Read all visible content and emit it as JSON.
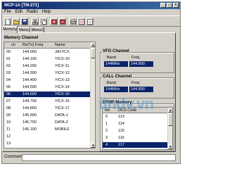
{
  "window": {
    "title": "MCP-1A [TM-271]",
    "controls": [
      "_",
      "□",
      "×"
    ]
  },
  "menu": [
    "File",
    "Edit",
    "Radio",
    "Help"
  ],
  "tabs": [
    "Memory",
    "Menu",
    "Menu2"
  ],
  "memory_channel": {
    "title": "Memory Channel",
    "columns": [
      "ch",
      "Rx(Tx) Freq",
      "Name"
    ],
    "rows": [
      {
        "ch": "00",
        "freq": "144.000",
        "name": "JA1YCX"
      },
      {
        "ch": "01",
        "freq": "144.100",
        "name": "YICX-10"
      },
      {
        "ch": "02",
        "freq": "144.200",
        "name": "YICX-11"
      },
      {
        "ch": "03",
        "freq": "144.300",
        "name": "YICX-12"
      },
      {
        "ch": "04",
        "freq": "144.400",
        "name": "YICX-13"
      },
      {
        "ch": "05",
        "freq": "144.500",
        "name": "YICX-14"
      },
      {
        "ch": "06",
        "freq": "144.600",
        "name": "YICX-15"
      },
      {
        "ch": "07",
        "freq": "144.700",
        "name": "YICX-16"
      },
      {
        "ch": "08",
        "freq": "144.800",
        "name": "YICX-17"
      },
      {
        "ch": "09",
        "freq": "145.600",
        "name": "DATA-1"
      },
      {
        "ch": "10",
        "freq": "145.700",
        "name": "DATA-2"
      },
      {
        "ch": "11",
        "freq": "145.100",
        "name": "MOBILE"
      },
      {
        "ch": "12",
        "freq": "",
        "name": ""
      },
      {
        "ch": "13",
        "freq": "",
        "name": ""
      }
    ],
    "selected_index": 6
  },
  "vfo_channel": {
    "title": "VFO Channel",
    "band_label": "Band",
    "freq_label": "Freq",
    "band": "144MHz",
    "freq": "144.800"
  },
  "call_channel": {
    "title": "CALL Channel",
    "band_label": "Band",
    "freq_label": "Freq",
    "band": "144MHz",
    "freq": "144.800"
  },
  "dcs_list": {
    "title": "DTMF Memory",
    "columns": [
      "No",
      "DCS Code"
    ],
    "rows": [
      {
        "no": "0",
        "code": "113"
      },
      {
        "no": "1",
        "code": "114"
      },
      {
        "no": "2",
        "code": "115"
      },
      {
        "no": "3",
        "code": "116"
      },
      {
        "no": "4",
        "code": "117"
      }
    ],
    "selected_index": 4
  },
  "watermark": "tindv.vn",
  "comment": {
    "label": "Comment",
    "value": ""
  },
  "colors": {
    "selection": "#0a246a",
    "face": "#d4d0c8",
    "watermark": "#3f8fd8"
  }
}
